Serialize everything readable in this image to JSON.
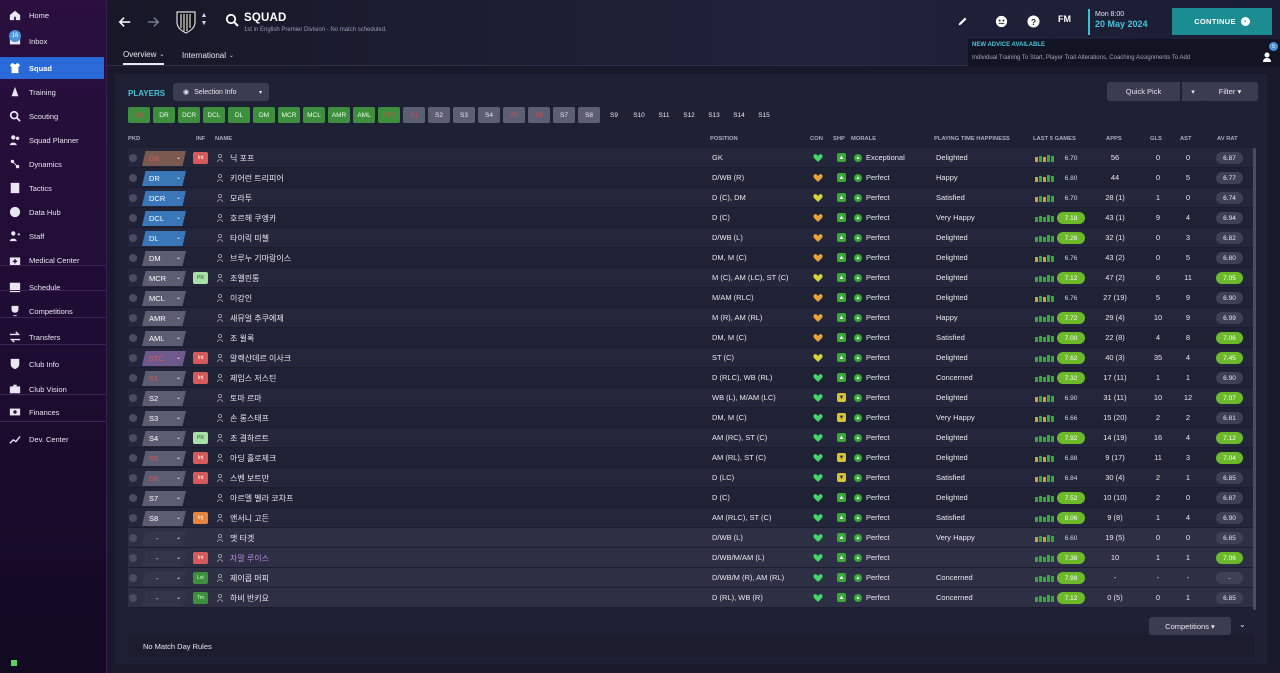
{
  "sidebar": {
    "items": [
      {
        "label": "Home",
        "icon": "home-icon"
      },
      {
        "label": "Inbox",
        "icon": "inbox-icon",
        "badge": "16"
      },
      {
        "label": "Squad",
        "icon": "shirt-icon",
        "active": true
      },
      {
        "label": "Training",
        "icon": "cone-icon"
      },
      {
        "label": "Scouting",
        "icon": "search-icon"
      },
      {
        "label": "Squad Planner",
        "icon": "people-icon"
      },
      {
        "label": "Dynamics",
        "icon": "dynamics-icon"
      },
      {
        "label": "Tactics",
        "icon": "tactics-board-icon"
      },
      {
        "label": "Data Hub",
        "icon": "data-hub-icon"
      },
      {
        "label": "Staff",
        "icon": "staff-icon"
      },
      {
        "label": "Medical Center",
        "icon": "medical-kit-icon"
      },
      {
        "label": "Schedule",
        "icon": "calendar-icon"
      },
      {
        "label": "Competitions",
        "icon": "trophy-icon"
      },
      {
        "label": "Transfers",
        "icon": "transfer-arrows-icon"
      },
      {
        "label": "Club Info",
        "icon": "shield-icon"
      },
      {
        "label": "Club Vision",
        "icon": "briefcase-icon"
      },
      {
        "label": "Finances",
        "icon": "money-icon"
      },
      {
        "label": "Dev. Center",
        "icon": "growth-icon"
      }
    ]
  },
  "header": {
    "title": "SQUAD",
    "subtitle": "1st in English Premier Division - No match scheduled.",
    "tabs": [
      {
        "label": "Overview"
      },
      {
        "label": "International"
      }
    ],
    "fm_logo": "FM",
    "date_day": "Mon 8:00",
    "date_full": "20 May 2024",
    "continue_label": "CONTINUE",
    "advice_title": "NEW ADVICE AVAILABLE",
    "advice_text": "Individual Training To Start, Player Trait Alterations, Coaching Assignments To Add",
    "advice_badge": "5"
  },
  "panel": {
    "players_title": "PLAYERS",
    "selection_info": "Selection Info",
    "quick_pick": "Quick Pick",
    "filter": "Filter",
    "competitions": "Competitions",
    "no_match_day_rules": "No Match Day Rules",
    "position_chips": [
      {
        "label": "GK",
        "style": "greenfaded"
      },
      {
        "label": "DR",
        "style": "green"
      },
      {
        "label": "DCR",
        "style": "green"
      },
      {
        "label": "DCL",
        "style": "green"
      },
      {
        "label": "DL",
        "style": "green"
      },
      {
        "label": "DM",
        "style": "green"
      },
      {
        "label": "MCR",
        "style": "green"
      },
      {
        "label": "MCL",
        "style": "green"
      },
      {
        "label": "AMR",
        "style": "green"
      },
      {
        "label": "AML",
        "style": "green"
      },
      {
        "label": "STC",
        "style": "greenfaded"
      },
      {
        "label": "S1",
        "style": "greyfaded"
      },
      {
        "label": "S2",
        "style": "grey"
      },
      {
        "label": "S3",
        "style": "grey"
      },
      {
        "label": "S4",
        "style": "grey"
      },
      {
        "label": "S5",
        "style": "greyfaded"
      },
      {
        "label": "S6",
        "style": "greyfaded"
      },
      {
        "label": "S7",
        "style": "grey"
      },
      {
        "label": "S8",
        "style": "grey"
      },
      {
        "label": "S9",
        "style": "dark"
      },
      {
        "label": "S10",
        "style": "dark"
      },
      {
        "label": "S11",
        "style": "dark"
      },
      {
        "label": "S12",
        "style": "dark"
      },
      {
        "label": "S13",
        "style": "dark"
      },
      {
        "label": "S14",
        "style": "dark"
      },
      {
        "label": "S15",
        "style": "dark"
      }
    ],
    "columns": {
      "pkd": "PKD",
      "inf": "INF",
      "name": "NAME",
      "position": "POSITION",
      "con": "CON",
      "shp": "SHP",
      "morale": "MORALE",
      "happiness": "PLAYING TIME HAPPINESS",
      "last5": "LAST 5 GAMES",
      "apps": "APPS",
      "gls": "GLS",
      "ast": "AST",
      "avrat": "AV RAT"
    },
    "players": [
      {
        "sel": "GK",
        "selStyle": "brown",
        "inf": "Int",
        "infStyle": "int",
        "name": "닉 포프",
        "position": "GK",
        "con": "heart-green",
        "shp": "g",
        "morale": "Exceptional",
        "happiness": "Delighted",
        "last5": "6.70",
        "last5hi": false,
        "apps": "56",
        "gls": "0",
        "ast": "0",
        "avrat": "6.87",
        "avhi": false
      },
      {
        "sel": "DR",
        "selStyle": "blue",
        "inf": "",
        "infStyle": "empty",
        "name": "키어런 트리피어",
        "position": "D/WB (R)",
        "con": "heart-amber",
        "shp": "g",
        "morale": "Perfect",
        "happiness": "Happy",
        "last5": "6.80",
        "last5hi": false,
        "apps": "44",
        "gls": "0",
        "ast": "5",
        "avrat": "6.77",
        "avhi": false
      },
      {
        "sel": "DCR",
        "selStyle": "blue",
        "inf": "",
        "infStyle": "empty",
        "name": "모라투",
        "position": "D (C), DM",
        "con": "heart-yellow",
        "shp": "g",
        "morale": "Perfect",
        "happiness": "Satisfied",
        "last5": "6.70",
        "last5hi": false,
        "apps": "28 (1)",
        "gls": "1",
        "ast": "0",
        "avrat": "6.74",
        "avhi": false
      },
      {
        "sel": "DCL",
        "selStyle": "blue",
        "inf": "",
        "infStyle": "empty",
        "name": "호르헤 쿠엥카",
        "position": "D (C)",
        "con": "heart-amber",
        "shp": "g",
        "morale": "Perfect",
        "happiness": "Very Happy",
        "last5": "7.18",
        "last5hi": true,
        "apps": "43 (1)",
        "gls": "9",
        "ast": "4",
        "avrat": "6.94",
        "avhi": false
      },
      {
        "sel": "DL",
        "selStyle": "blue",
        "inf": "",
        "infStyle": "empty",
        "name": "타이릭 미첼",
        "position": "D/WB (L)",
        "con": "heart-amber",
        "shp": "g",
        "morale": "Perfect",
        "happiness": "Delighted",
        "last5": "7.26",
        "last5hi": true,
        "apps": "32 (1)",
        "gls": "0",
        "ast": "3",
        "avrat": "6.82",
        "avhi": false
      },
      {
        "sel": "DM",
        "selStyle": "gray",
        "inf": "",
        "infStyle": "empty",
        "name": "브루누 기마랑이스",
        "position": "DM, M (C)",
        "con": "heart-amber",
        "shp": "g",
        "morale": "Perfect",
        "happiness": "Delighted",
        "last5": "6.76",
        "last5hi": false,
        "apps": "43 (2)",
        "gls": "0",
        "ast": "5",
        "avrat": "6.80",
        "avhi": false
      },
      {
        "sel": "MCR",
        "selStyle": "gray",
        "inf": "PR",
        "infStyle": "pr",
        "name": "조엘린통",
        "position": "M (C), AM (LC), ST (C)",
        "con": "heart-yellow",
        "shp": "g",
        "morale": "Perfect",
        "happiness": "Delighted",
        "last5": "7.12",
        "last5hi": true,
        "apps": "47 (2)",
        "gls": "6",
        "ast": "11",
        "avrat": "7.05",
        "avhi": true
      },
      {
        "sel": "MCL",
        "selStyle": "gray",
        "inf": "",
        "infStyle": "empty",
        "name": "이강인",
        "position": "M/AM (RLC)",
        "con": "heart-amber",
        "shp": "g",
        "morale": "Perfect",
        "happiness": "Delighted",
        "last5": "6.76",
        "last5hi": false,
        "apps": "27 (19)",
        "gls": "5",
        "ast": "9",
        "avrat": "6.90",
        "avhi": false
      },
      {
        "sel": "AMR",
        "selStyle": "gray",
        "inf": "",
        "infStyle": "empty",
        "name": "새뮤얼 추쿠에제",
        "position": "M (R), AM (RL)",
        "con": "heart-amber",
        "shp": "g",
        "morale": "Perfect",
        "happiness": "Happy",
        "last5": "7.72",
        "last5hi": true,
        "apps": "29 (4)",
        "gls": "10",
        "ast": "9",
        "avrat": "6.99",
        "avhi": false
      },
      {
        "sel": "AML",
        "selStyle": "gray",
        "inf": "",
        "infStyle": "empty",
        "name": "조 윌록",
        "position": "DM, M (C)",
        "con": "heart-amber",
        "shp": "g",
        "morale": "Perfect",
        "happiness": "Satisfied",
        "last5": "7.00",
        "last5hi": true,
        "apps": "22 (8)",
        "gls": "4",
        "ast": "8",
        "avrat": "7.06",
        "avhi": true
      },
      {
        "sel": "STC",
        "selStyle": "purple",
        "inf": "Int",
        "infStyle": "int",
        "name": "알렉산데르 이사크",
        "position": "ST (C)",
        "con": "heart-yellow",
        "shp": "g",
        "morale": "Perfect",
        "happiness": "Delighted",
        "last5": "7.62",
        "last5hi": true,
        "apps": "40 (3)",
        "gls": "35",
        "ast": "4",
        "avrat": "7.45",
        "avhi": true
      },
      {
        "sel": "S1",
        "selStyle": "grayred",
        "inf": "Int",
        "infStyle": "int",
        "name": "제임스 저스틴",
        "position": "D (RLC), WB (RL)",
        "con": "heart-green",
        "shp": "g",
        "morale": "Perfect",
        "happiness": "Concerned",
        "last5": "7.32",
        "last5hi": true,
        "apps": "17 (11)",
        "gls": "1",
        "ast": "1",
        "avrat": "6.90",
        "avhi": false
      },
      {
        "sel": "S2",
        "selStyle": "gray",
        "inf": "",
        "infStyle": "empty",
        "name": "토마 르마",
        "position": "WB (L), M/AM (LC)",
        "con": "heart-green",
        "shp": "y",
        "morale": "Perfect",
        "happiness": "Delighted",
        "last5": "6.90",
        "last5hi": false,
        "apps": "31 (11)",
        "gls": "10",
        "ast": "12",
        "avrat": "7.07",
        "avhi": true
      },
      {
        "sel": "S3",
        "selStyle": "gray",
        "inf": "",
        "infStyle": "empty",
        "name": "손 롱스태프",
        "position": "DM, M (C)",
        "con": "heart-green",
        "shp": "y",
        "morale": "Perfect",
        "happiness": "Very Happy",
        "last5": "6.66",
        "last5hi": false,
        "apps": "15 (20)",
        "gls": "2",
        "ast": "2",
        "avrat": "6.81",
        "avhi": false
      },
      {
        "sel": "S4",
        "selStyle": "gray",
        "inf": "PR",
        "infStyle": "pr",
        "name": "조 결하르트",
        "position": "AM (RC), ST (C)",
        "con": "heart-green",
        "shp": "g",
        "morale": "Perfect",
        "happiness": "Delighted",
        "last5": "7.92",
        "last5hi": true,
        "apps": "14 (19)",
        "gls": "16",
        "ast": "4",
        "avrat": "7.12",
        "avhi": true
      },
      {
        "sel": "S5",
        "selStyle": "grayred",
        "inf": "Int",
        "infStyle": "int",
        "name": "아딩 홀로제크",
        "position": "AM (RL), ST (C)",
        "con": "heart-green",
        "shp": "y",
        "morale": "Perfect",
        "happiness": "Delighted",
        "last5": "6.88",
        "last5hi": false,
        "apps": "9 (17)",
        "gls": "11",
        "ast": "3",
        "avrat": "7.04",
        "avhi": true
      },
      {
        "sel": "S6",
        "selStyle": "grayred",
        "inf": "Int",
        "infStyle": "int",
        "name": "스벤 보트만",
        "position": "D (LC)",
        "con": "heart-green",
        "shp": "y",
        "morale": "Perfect",
        "happiness": "Satisfied",
        "last5": "6.84",
        "last5hi": false,
        "apps": "30 (4)",
        "gls": "2",
        "ast": "1",
        "avrat": "6.85",
        "avhi": false
      },
      {
        "sel": "S7",
        "selStyle": "gray",
        "inf": "",
        "infStyle": "empty",
        "name": "아르멜 벨라 코차프",
        "position": "D (C)",
        "con": "heart-green",
        "shp": "g",
        "morale": "Perfect",
        "happiness": "Delighted",
        "last5": "7.52",
        "last5hi": true,
        "apps": "10 (10)",
        "gls": "2",
        "ast": "0",
        "avrat": "6.87",
        "avhi": false
      },
      {
        "sel": "S8",
        "selStyle": "gray",
        "inf": "Inj",
        "infStyle": "inj",
        "name": "앤서니 고든",
        "position": "AM (RLC), ST (C)",
        "con": "heart-green",
        "shp": "g",
        "morale": "Perfect",
        "happiness": "Satisfied",
        "last5": "8.06",
        "last5hi": true,
        "apps": "9 (8)",
        "gls": "1",
        "ast": "4",
        "avrat": "6.90",
        "avhi": false
      },
      {
        "sel": "-",
        "selStyle": "none",
        "inf": "",
        "infStyle": "empty",
        "name": "맷 타겟",
        "position": "D/WB (L)",
        "con": "heart-green",
        "shp": "g",
        "morale": "Perfect",
        "happiness": "Very Happy",
        "last5": "6.60",
        "last5hi": false,
        "apps": "19 (5)",
        "gls": "0",
        "ast": "0",
        "avrat": "6.85",
        "avhi": false
      },
      {
        "sel": "-",
        "selStyle": "none",
        "inf": "Int",
        "infStyle": "int",
        "name": "자말 루이스",
        "namePurple": true,
        "position": "D/WB/M/AM (L)",
        "con": "heart-green",
        "shp": "g",
        "morale": "Perfect",
        "happiness": "",
        "last5": "7.38",
        "last5hi": true,
        "apps": "10",
        "gls": "1",
        "ast": "1",
        "avrat": "7.06",
        "avhi": true
      },
      {
        "sel": "-",
        "selStyle": "none",
        "inf": "Lst",
        "infStyle": "lst",
        "name": "제이콥 머피",
        "position": "D/WB/M (R), AM (RL)",
        "con": "heart-green",
        "shp": "g",
        "morale": "Perfect",
        "happiness": "Concerned",
        "last5": "7.98",
        "last5hi": true,
        "apps": "-",
        "gls": "-",
        "ast": "-",
        "avrat": "-",
        "avhi": false
      },
      {
        "sel": "-",
        "selStyle": "none",
        "inf": "Trn",
        "infStyle": "trn",
        "name": "하비 반키요",
        "position": "D (RL), WB (R)",
        "con": "heart-green",
        "shp": "g",
        "morale": "Perfect",
        "happiness": "Concerned",
        "last5": "7.12",
        "last5hi": true,
        "apps": "0 (5)",
        "gls": "0",
        "ast": "1",
        "avrat": "6.85",
        "avhi": false
      }
    ]
  },
  "colors": {
    "accent": "#49c3d8",
    "sidebar_active": "#2a6ad8",
    "good": "#6cba2a",
    "continue": "#1b8c92"
  }
}
